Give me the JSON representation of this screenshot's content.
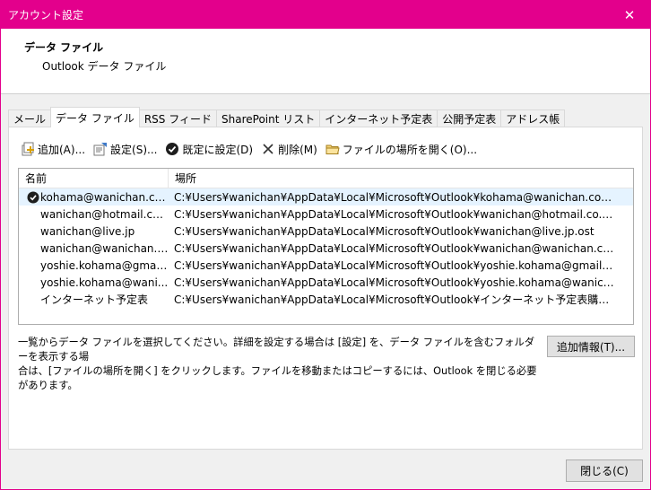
{
  "window": {
    "title": "アカウント設定",
    "close_glyph": "✕"
  },
  "header": {
    "title": "データ ファイル",
    "subtitle": "Outlook データ ファイル"
  },
  "tabs": [
    {
      "label": "メール",
      "active": false
    },
    {
      "label": "データ ファイル",
      "active": true
    },
    {
      "label": "RSS フィード",
      "active": false
    },
    {
      "label": "SharePoint リスト",
      "active": false
    },
    {
      "label": "インターネット予定表",
      "active": false
    },
    {
      "label": "公開予定表",
      "active": false
    },
    {
      "label": "アドレス帳",
      "active": false
    }
  ],
  "toolbar": {
    "add": {
      "label": "追加(A)...",
      "icon": "add-file-icon"
    },
    "settings": {
      "label": "設定(S)...",
      "icon": "settings-file-icon"
    },
    "default": {
      "label": "既定に設定(D)",
      "icon": "check-circle-icon"
    },
    "delete": {
      "label": "削除(M)",
      "icon": "delete-x-icon"
    },
    "open_location": {
      "label": "ファイルの場所を開く(O)...",
      "icon": "folder-icon"
    }
  },
  "list": {
    "columns": {
      "name": "名前",
      "location": "場所"
    },
    "rows": [
      {
        "name": "kohama@wanichan.com",
        "location": "C:¥Users¥wanichan¥AppData¥Local¥Microsoft¥Outlook¥kohama@wanichan.com....",
        "default": true
      },
      {
        "name": "wanichan@hotmail.co.jp",
        "location": "C:¥Users¥wanichan¥AppData¥Local¥Microsoft¥Outlook¥wanichan@hotmail.co.jp....",
        "default": false
      },
      {
        "name": "wanichan@live.jp",
        "location": "C:¥Users¥wanichan¥AppData¥Local¥Microsoft¥Outlook¥wanichan@live.jp.ost",
        "default": false
      },
      {
        "name": "wanichan@wanichan.c...",
        "location": "C:¥Users¥wanichan¥AppData¥Local¥Microsoft¥Outlook¥wanichan@wanichan.com....",
        "default": false
      },
      {
        "name": "yoshie.kohama@gmai...",
        "location": "C:¥Users¥wanichan¥AppData¥Local¥Microsoft¥Outlook¥yoshie.kohama@gmail.co....",
        "default": false
      },
      {
        "name": "yoshie.kohama@wani...",
        "location": "C:¥Users¥wanichan¥AppData¥Local¥Microsoft¥Outlook¥yoshie.kohama@wanicha....",
        "default": false
      },
      {
        "name": "インターネット予定表",
        "location": "C:¥Users¥wanichan¥AppData¥Local¥Microsoft¥Outlook¥インターネット予定表購読.pst",
        "default": false
      }
    ]
  },
  "description": {
    "line1": "一覧からデータ ファイルを選択してください。詳細を設定する場合は [設定] を、データ ファイルを含むフォルダーを表示する場",
    "line2": "合は、[ファイルの場所を開く] をクリックします。ファイルを移動またはコピーするには、Outlook を閉じる必要があります。"
  },
  "buttons": {
    "more_info": "追加情報(T)...",
    "close": "閉じる(C)"
  },
  "colors": {
    "titlebar": "#e3008c",
    "selection": "#e5f3ff"
  }
}
